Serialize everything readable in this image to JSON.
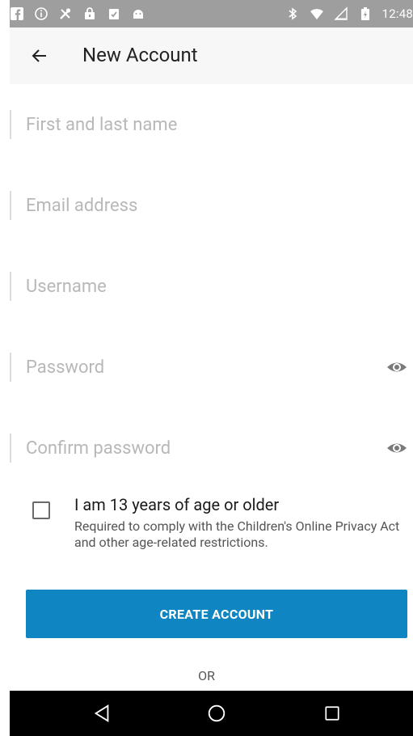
{
  "status_bar": {
    "time": "12:48",
    "left_icons": [
      "facebook-icon",
      "info-icon",
      "tools-icon",
      "lock-bag-icon",
      "clipboard-check-icon",
      "android-icon"
    ],
    "right_icons": [
      "bluetooth-icon",
      "wifi-icon",
      "signal-icon",
      "battery-icon"
    ]
  },
  "header": {
    "title": "New Account",
    "back_icon": "arrow-left-icon"
  },
  "form": {
    "name_placeholder": "First and last name",
    "email_placeholder": "Email address",
    "username_placeholder": "Username",
    "password_placeholder": "Password",
    "confirm_password_placeholder": "Confirm password",
    "eye_icon": "eye-icon"
  },
  "age_check": {
    "label": "I am 13 years of age or older",
    "description": "Required to comply with the Children's Online Privacy Act and other age-related restrictions.",
    "checked": false
  },
  "actions": {
    "create_label": "CREATE ACCOUNT",
    "or_label": "OR"
  },
  "nav_bar": {
    "icons": [
      "back-triangle-icon",
      "home-circle-icon",
      "recents-square-icon"
    ]
  },
  "colors": {
    "status_bar": "#9e9e9e",
    "toolbar": "#f7f7f7",
    "accent_button": "#0f86c2",
    "nav_bar": "#000000"
  }
}
